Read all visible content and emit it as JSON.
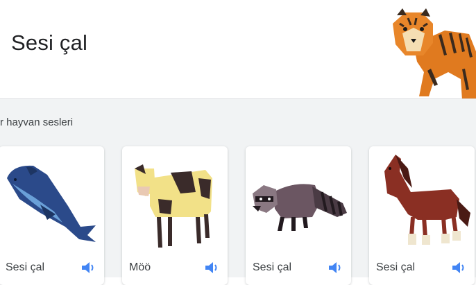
{
  "header": {
    "title": "Sesi çal",
    "tiger_icon": "tiger-illustration"
  },
  "section": {
    "label": "r hayvan sesleri"
  },
  "cards": [
    {
      "animal_icon": "whale-illustration",
      "label": "Sesi çal",
      "sound_icon": "speaker-icon"
    },
    {
      "animal_icon": "cow-illustration",
      "label": "Möö",
      "sound_icon": "speaker-icon"
    },
    {
      "animal_icon": "raccoon-illustration",
      "label": "Sesi çal",
      "sound_icon": "speaker-icon"
    },
    {
      "animal_icon": "horse-illustration",
      "label": "Sesi çal",
      "sound_icon": "speaker-icon"
    }
  ],
  "colors": {
    "speaker_blue": "#4285f4",
    "panel_bg": "#f1f3f4",
    "card_bg": "#ffffff"
  }
}
